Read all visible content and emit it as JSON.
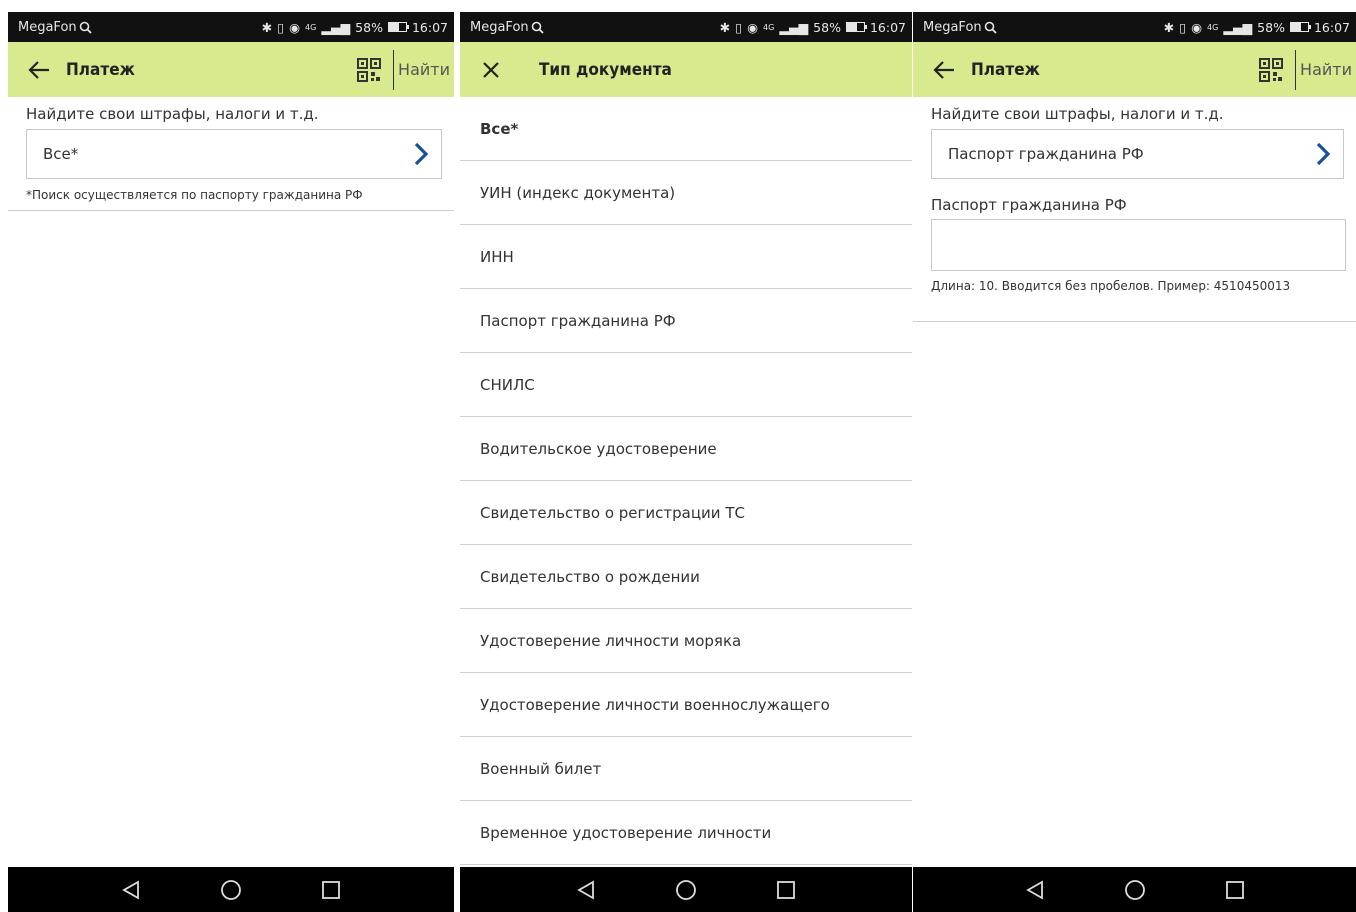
{
  "status_bar": {
    "carrier": "MegaFon",
    "network": "4G",
    "battery": "58%",
    "battery_level": 0.58,
    "time": "16:07"
  },
  "screen1": {
    "title": "Платеж",
    "find_label": "Найти",
    "search_label": "Найдите свои штрафы, налоги и т.д.",
    "doc_type_value": "Все*",
    "footnote": "*Поиск осуществляется по паспорту гражданина РФ"
  },
  "screen2": {
    "title": "Тип документа",
    "items": [
      "Все*",
      "УИН (индекс документа)",
      "ИНН",
      "Паспорт гражданина РФ",
      "СНИЛС",
      "Водительское удостоверение",
      "Свидетельство о регистрации ТС",
      "Свидетельство о рождении",
      "Удостоверение личности моряка",
      "Удостоверение личности военнослужащего",
      "Военный билет",
      "Временное удостоверение личности"
    ]
  },
  "screen3": {
    "title": "Платеж",
    "find_label": "Найти",
    "search_label": "Найдите свои штрафы, налоги и т.д.",
    "doc_type_value": "Паспорт гражданина РФ",
    "field_label": "Паспорт гражданина РФ",
    "field_value": "",
    "field_hint": "Длина: 10. Вводится без пробелов. Пример: 4510450013"
  },
  "icons": {
    "back": "arrow-left-icon",
    "close": "close-icon",
    "qr": "qr-code-icon",
    "chevron": "chevron-right-icon",
    "search": "search-icon",
    "nav_back": "triangle-back-icon",
    "nav_home": "circle-home-icon",
    "nav_recent": "square-recent-icon"
  },
  "colors": {
    "appbar": "#d8ea8e",
    "chevron": "#1a4f9c",
    "statusbar": "#111111",
    "navbar": "#000000"
  }
}
